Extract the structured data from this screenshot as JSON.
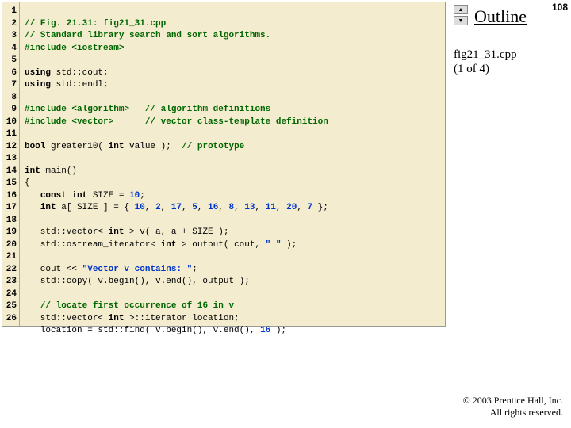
{
  "slide": {
    "outline_label": "Outline",
    "page_number": "108",
    "file_label_line1": "fig21_31.cpp",
    "file_label_line2": "(1 of 4)",
    "copyright_line1": "© 2003 Prentice Hall, Inc.",
    "copyright_line2": "All rights reserved.",
    "nav_up": "▲",
    "nav_down": "▼"
  },
  "gutter": {
    "l1": "1",
    "l2": "2",
    "l3": "3",
    "l4": "4",
    "l5": "5",
    "l6": "6",
    "l7": "7",
    "l8": "8",
    "l9": "9",
    "l10": "10",
    "l11": "11",
    "l12": "12",
    "l13": "13",
    "l14": "14",
    "l15": "15",
    "l16": "16",
    "l17": "17",
    "l18": "18",
    "l19": "19",
    "l20": "20",
    "l21": "21",
    "l22": "22",
    "l23": "23",
    "l24": "24",
    "l25": "25",
    "l26": "26"
  },
  "code": {
    "c1a": "// Fig. 21.31: fig21_31.cpp",
    "c2a": "// Standard library search and sort algorithms.",
    "c3a": "#include <iostream>",
    "c5a": "using",
    "c5b": " std::cout;",
    "c6a": "using",
    "c6b": " std::endl;",
    "c8a": "#include <algorithm>",
    "c8b": "   // algorithm definitions",
    "c9a": "#include <vector>",
    "c9b": "      // vector class-template definition",
    "c11a": "bool",
    "c11b": " greater10( ",
    "c11c": "int",
    "c11d": " value );  ",
    "c11e": "// prototype",
    "c13a": "int",
    "c13b": " main()",
    "c14a": "{",
    "c15a": "   ",
    "c15b": "const int",
    "c15c": " SIZE = ",
    "c15d": "10",
    "c15e": ";",
    "c16a": "   ",
    "c16b": "int",
    "c16c": " a[ SIZE ] = { ",
    "c16d": "10",
    "c16e": ", ",
    "c16f": "2",
    "c16g": ", ",
    "c16h": "17",
    "c16i": ", ",
    "c16j": "5",
    "c16k": ", ",
    "c16l": "16",
    "c16m": ", ",
    "c16n": "8",
    "c16o": ", ",
    "c16p": "13",
    "c16q": ", ",
    "c16r": "11",
    "c16s": ", ",
    "c16t": "20",
    "c16u": ", ",
    "c16v": "7",
    "c16w": " };",
    "c18a": "   std::vector< ",
    "c18b": "int",
    "c18c": " > v( a, a + SIZE );",
    "c19a": "   std::ostream_iterator< ",
    "c19b": "int",
    "c19c": " > output( cout, ",
    "c19d": "\" \"",
    "c19e": " );",
    "c21a": "   cout << ",
    "c21b": "\"Vector v contains: \"",
    "c21c": ";",
    "c22a": "   std::copy( v.begin(), v.end(), output );",
    "c24a": "   ",
    "c24b": "// locate first occurrence of 16 in v",
    "c25a": "   std::vector< ",
    "c25b": "int",
    "c25c": " >::iterator location;",
    "c26a": "   location = std::find( v.begin(), v.end(), ",
    "c26b": "16",
    "c26c": " );"
  }
}
